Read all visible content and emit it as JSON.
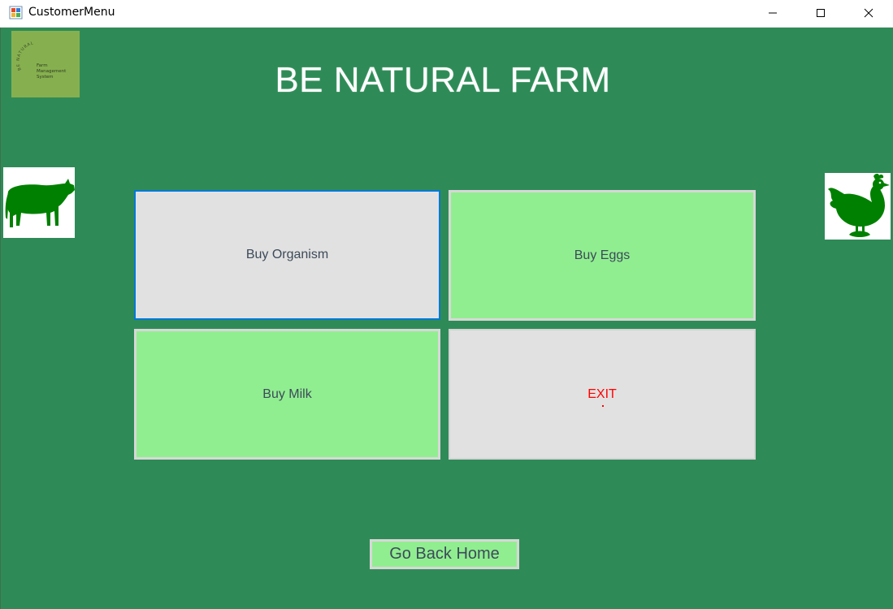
{
  "window": {
    "title": "CustomerMenu",
    "icon": "app-window-icon",
    "controls": [
      "minimize-icon",
      "maximize-icon",
      "close-icon"
    ]
  },
  "header": {
    "title": "BE NATURAL FARM",
    "logo": {
      "arc_text": "BE NATURAL",
      "lines": [
        "Farm",
        "Management",
        "System"
      ]
    }
  },
  "images": {
    "left": "cow-icon",
    "right": "hen-icon"
  },
  "menu": {
    "buy_organism": "Buy Organism",
    "buy_eggs": "Buy Eggs",
    "buy_milk": "Buy Milk",
    "exit": "EXIT"
  },
  "footer": {
    "home_button": "Go Back Home"
  },
  "colors": {
    "background": "#2e8b57",
    "tile_green": "#90ee90",
    "tile_gray": "#e1e1e1",
    "focus": "#0078d7",
    "exit_text": "#ff0000",
    "silhouette": "#008000"
  }
}
